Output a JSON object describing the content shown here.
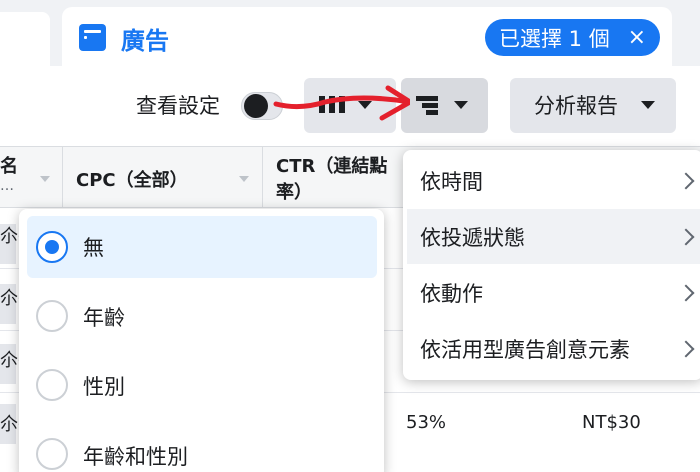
{
  "tabs": {
    "ads_label": "廣告",
    "selected_label": "已選擇 1 個",
    "clear_symbol": "×"
  },
  "toolbar": {
    "view_settings_label": "查看設定",
    "report_label": "分析報告"
  },
  "table": {
    "headers": [
      {
        "line1": "名",
        "line2": "…"
      },
      {
        "line1": "CPC（全部）",
        "line2": ""
      },
      {
        "line1": "CTR（連結點",
        "line2": "率）"
      }
    ],
    "row_fragments": [
      "尒平",
      "尒平",
      "尒平",
      "尒平"
    ],
    "ctr_value": "53%",
    "cpc_value": "NT$30"
  },
  "breakdown_menu": {
    "options": [
      {
        "label": "無",
        "selected": true
      },
      {
        "label": "年齡",
        "selected": false
      },
      {
        "label": "性別",
        "selected": false
      },
      {
        "label": "年齡和性別",
        "selected": false
      }
    ]
  },
  "submenu": {
    "items": [
      {
        "label": "依時間"
      },
      {
        "label": "依投遞狀態"
      },
      {
        "label": "依動作"
      },
      {
        "label": "依活用型廣告創意元素"
      }
    ]
  },
  "colors": {
    "accent": "#1877f2",
    "annotation_arrow": "#e4202c"
  }
}
